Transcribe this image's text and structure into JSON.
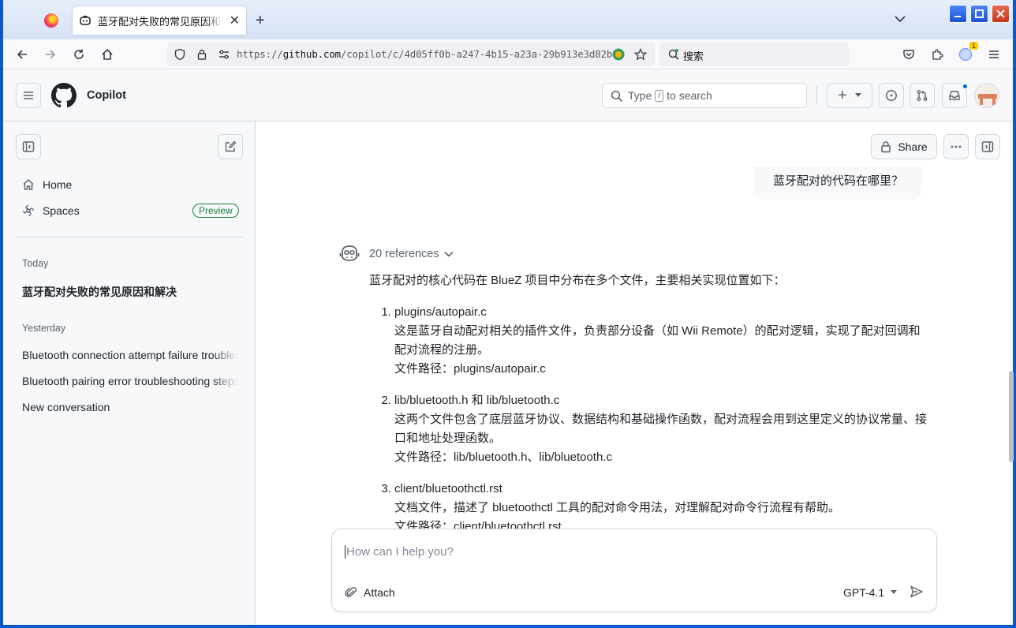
{
  "browser": {
    "tab_title": "蓝牙配对失败的常见原因和解决",
    "tab_close": "✕",
    "new_tab": "+",
    "url_prefix": "https://",
    "url_host": "github.com",
    "url_path": "/copilot/c/4d05ff0b-a247-4b15-a23a-29b913e3d82b",
    "search_label": "搜索",
    "extension_badge": "1"
  },
  "header": {
    "app_title": "Copilot",
    "search_type": "Type",
    "search_key": "/",
    "search_rest": "to search",
    "plus": "+"
  },
  "sidebar": {
    "items": [
      {
        "label": "Home"
      },
      {
        "label": "Spaces",
        "badge": "Preview"
      }
    ],
    "today_heading": "Today",
    "today": [
      "蓝牙配对失败的常见原因和解决"
    ],
    "yesterday_heading": "Yesterday",
    "yesterday": [
      "Bluetooth connection attempt failure troubleshooting",
      "Bluetooth pairing error troubleshooting steps",
      "New conversation"
    ]
  },
  "main": {
    "share_label": "Share",
    "user_message": "蓝牙配对的代码在哪里？",
    "references_label": "20 references",
    "answer_intro": "蓝牙配对的核心代码在 BlueZ 项目中分布在多个文件，主要相关实现位置如下：",
    "answer_items": [
      {
        "title": "plugins/autopair.c",
        "desc": "这是蓝牙自动配对相关的插件文件，负责部分设备（如 Wii Remote）的配对逻辑，实现了配对回调和配对流程的注册。",
        "path": "文件路径：plugins/autopair.c"
      },
      {
        "title": "lib/bluetooth.h 和 lib/bluetooth.c",
        "desc": "这两个文件包含了底层蓝牙协议、数据结构和基础操作函数，配对流程会用到这里定义的协议常量、接口和地址处理函数。",
        "path": "文件路径：lib/bluetooth.h、lib/bluetooth.c"
      },
      {
        "title": "client/bluetoothctl.rst",
        "desc": "文档文件，描述了 bluetoothctl 工具的配对命令用法，对理解配对命令行流程有帮助。",
        "path": "文件路径：client/bluetoothctl.rst"
      }
    ],
    "composer": {
      "placeholder": "How can I help you?",
      "attach_label": "Attach",
      "model_label": "GPT-4.1"
    }
  }
}
